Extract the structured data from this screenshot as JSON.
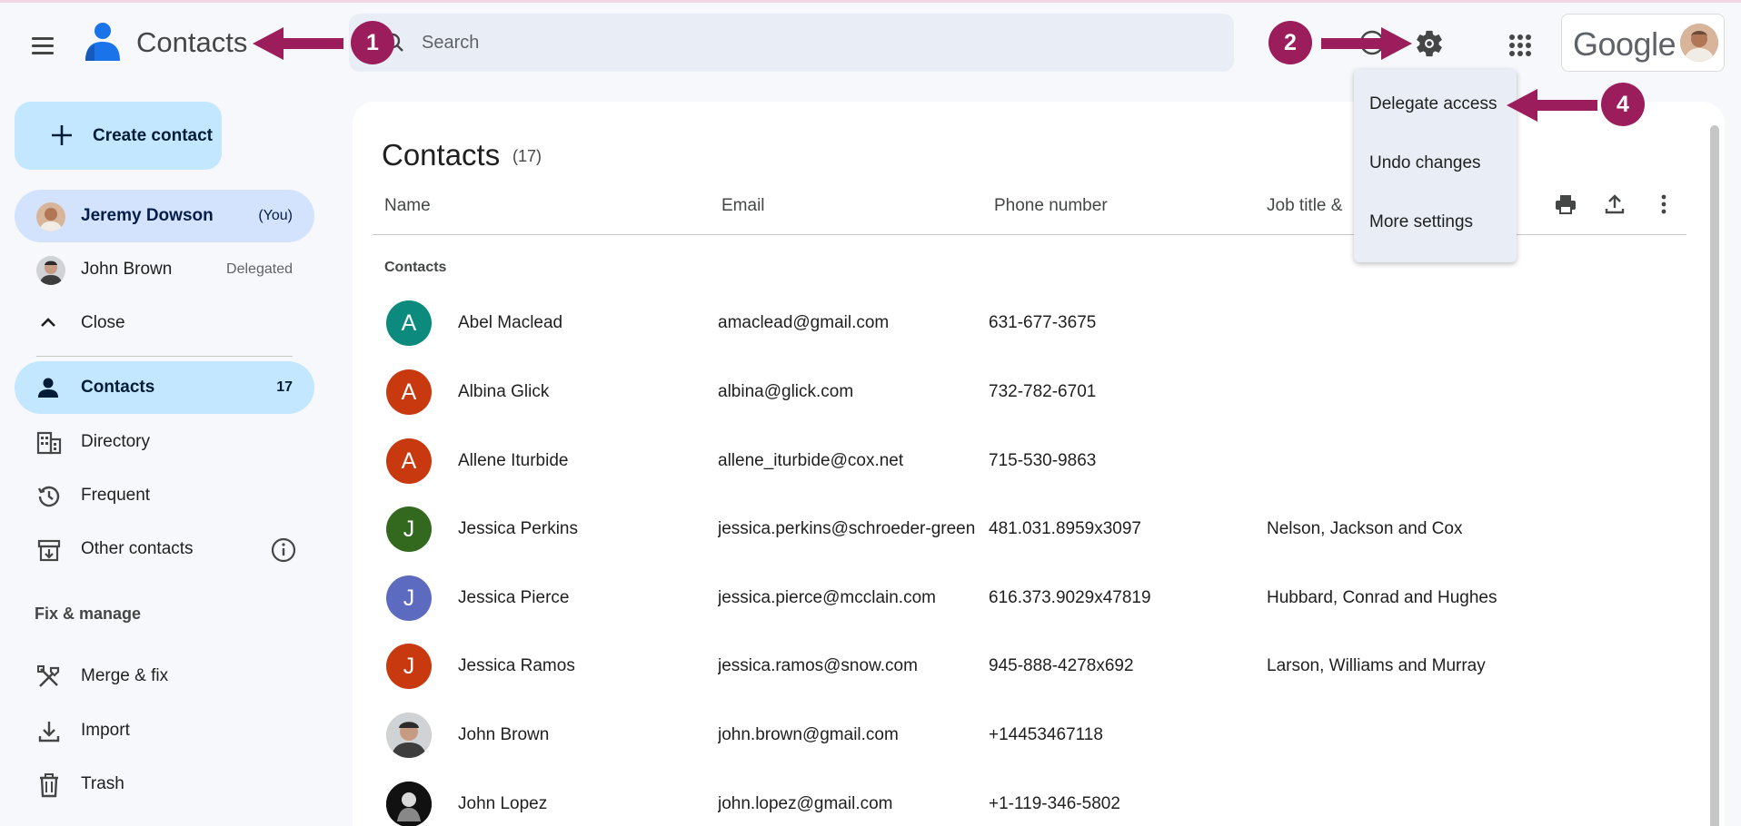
{
  "header": {
    "app_title": "Contacts",
    "search_placeholder": "Search",
    "brand_word": "Google"
  },
  "sidebar": {
    "create_label": "Create contact",
    "accounts": [
      {
        "name": "Jeremy Dowson",
        "meta": "(You)"
      },
      {
        "name": "John Brown",
        "meta": "Delegated"
      }
    ],
    "close_label": "Close",
    "items": [
      {
        "label": "Contacts",
        "meta": "17",
        "icon": "person-icon"
      },
      {
        "label": "Directory",
        "icon": "building-icon"
      },
      {
        "label": "Frequent",
        "icon": "history-icon"
      },
      {
        "label": "Other contacts",
        "icon": "archive-download-icon"
      }
    ],
    "fix_manage_title": "Fix & manage",
    "fix_items": [
      {
        "label": "Merge & fix",
        "icon": "tools-icon"
      },
      {
        "label": "Import",
        "icon": "download-icon"
      },
      {
        "label": "Trash",
        "icon": "trash-icon"
      }
    ]
  },
  "main": {
    "title": "Contacts",
    "count": "(17)",
    "columns": {
      "name": "Name",
      "email": "Email",
      "phone": "Phone number",
      "job": "Job title &"
    },
    "group_label": "Contacts",
    "rows": [
      {
        "initial": "A",
        "color": "#0b8a7d",
        "name": "Abel Maclead",
        "email": "amaclead@gmail.com",
        "phone": "631-677-3675",
        "job": ""
      },
      {
        "initial": "A",
        "color": "#c9390f",
        "name": "Albina Glick",
        "email": "albina@glick.com",
        "phone": "732-782-6701",
        "job": ""
      },
      {
        "initial": "A",
        "color": "#c9390f",
        "name": "Allene Iturbide",
        "email": "allene_iturbide@cox.net",
        "phone": "715-530-9863",
        "job": ""
      },
      {
        "initial": "J",
        "color": "#33691e",
        "name": "Jessica Perkins",
        "email": "jessica.perkins@schroeder-green",
        "phone": "481.031.8959x3097",
        "job": "Nelson, Jackson and Cox"
      },
      {
        "initial": "J",
        "color": "#5c6bc0",
        "name": "Jessica Pierce",
        "email": "jessica.pierce@mcclain.com",
        "phone": "616.373.9029x47819",
        "job": "Hubbard, Conrad and Hughes"
      },
      {
        "initial": "J",
        "color": "#c9390f",
        "name": "Jessica Ramos",
        "email": "jessica.ramos@snow.com",
        "phone": "945-888-4278x692",
        "job": "Larson, Williams and Murray"
      },
      {
        "initial": "",
        "color": "#6d6d6d",
        "name": "John Brown",
        "email": "john.brown@gmail.com",
        "phone": "+14453467118",
        "job": ""
      },
      {
        "initial": "",
        "color": "#111111",
        "name": "John Lopez",
        "email": "john.lopez@gmail.com",
        "phone": "+1-119-346-5802",
        "job": ""
      }
    ]
  },
  "settings_menu": {
    "items": [
      "Delegate access",
      "Undo changes",
      "More settings"
    ]
  },
  "annotations": {
    "badges": [
      "1",
      "2",
      "4"
    ],
    "color": "#9c1d5c"
  }
}
